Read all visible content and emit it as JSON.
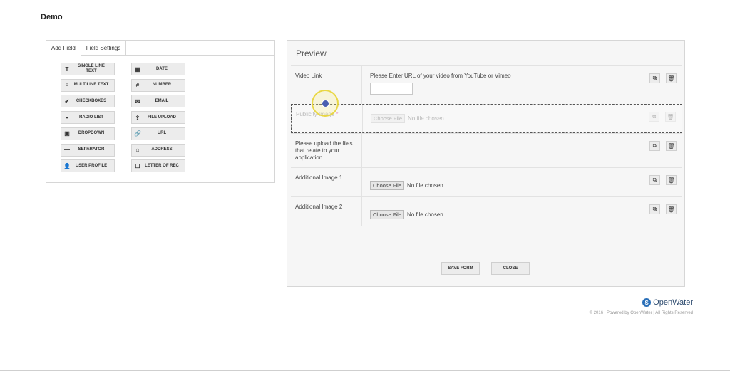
{
  "page": {
    "title": "Demo"
  },
  "left_panel": {
    "tabs": [
      {
        "label": "Add Field",
        "active": true
      },
      {
        "label": "Field Settings",
        "active": false
      }
    ],
    "fields_left": [
      {
        "label": "SINGLE LINE TEXT",
        "icon": "T",
        "icon_name": "text-icon"
      },
      {
        "label": "MULTILINE TEXT",
        "icon": "≡",
        "icon_name": "paragraph-icon"
      },
      {
        "label": "CHECKBOXES",
        "icon": "✔",
        "icon_name": "check-icon"
      },
      {
        "label": "RADIO LIST",
        "icon": "•",
        "icon_name": "radio-icon"
      },
      {
        "label": "DROPDOWN",
        "icon": "▣",
        "icon_name": "dropdown-icon"
      },
      {
        "label": "SEPARATOR",
        "icon": "—",
        "icon_name": "separator-icon"
      },
      {
        "label": "USER PROFILE",
        "icon": "👤",
        "icon_name": "user-icon"
      }
    ],
    "fields_right": [
      {
        "label": "DATE",
        "icon": "▦",
        "icon_name": "calendar-icon"
      },
      {
        "label": "NUMBER",
        "icon": "#",
        "icon_name": "number-icon"
      },
      {
        "label": "EMAIL",
        "icon": "✉",
        "icon_name": "email-icon"
      },
      {
        "label": "FILE UPLOAD",
        "icon": "⇪",
        "icon_name": "upload-icon"
      },
      {
        "label": "URL",
        "icon": "🔗",
        "icon_name": "link-icon"
      },
      {
        "label": "ADDRESS",
        "icon": "⌂",
        "icon_name": "home-icon"
      },
      {
        "label": "LETTER OF REC",
        "icon": "☐",
        "icon_name": "document-icon"
      }
    ]
  },
  "preview": {
    "title": "Preview",
    "rows": [
      {
        "label": "Video Link",
        "type": "text",
        "text": "Please Enter URL of your video from YouTube or Vimeo"
      },
      {
        "label": "Publicity Image",
        "type": "file",
        "required": true,
        "dragging": true
      },
      {
        "label": "Please upload the files that relate to your application.",
        "type": "static"
      },
      {
        "label": "Additional Image 1",
        "type": "file"
      },
      {
        "label": "Additional Image 2",
        "type": "file"
      }
    ],
    "choose_file_label": "Choose File",
    "no_file_label": "No file chosen",
    "required_marker": "*",
    "copy_icon": "⧉",
    "delete_icon": "🗑",
    "save_label": "SAVE FORM",
    "close_label": "CLOSE"
  },
  "footer": {
    "brand": "OpenWater",
    "brand_mark": "S",
    "copyright": "© 2016 | Powered by OpenWater | All Rights Reserved"
  }
}
